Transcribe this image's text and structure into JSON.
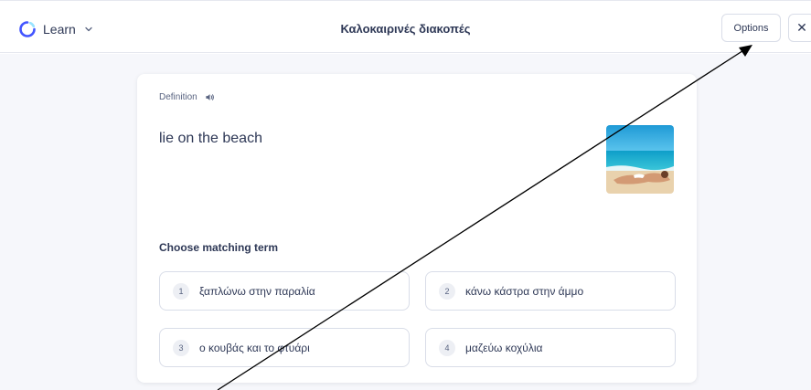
{
  "header": {
    "mode_label": "Learn",
    "mode_icon": "learn-mode-icon",
    "title": "Καλοκαιρινές διακοπές",
    "options_label": "Options",
    "close_label": "✕"
  },
  "question": {
    "definition_label": "Definition",
    "prompt": "lie on the beach",
    "image_subject": "woman sunbathing on the beach",
    "choose_label": "Choose matching term"
  },
  "answers": [
    {
      "number": "1",
      "text": "ξαπλώνω στην παραλία"
    },
    {
      "number": "2",
      "text": "κάνω κάστρα στην άμμο"
    },
    {
      "number": "3",
      "text": "ο κουβάς και το φτυάρι"
    },
    {
      "number": "4",
      "text": "μαζεύω κοχύλια"
    }
  ],
  "colors": {
    "accent": "#4255ff",
    "text": "#2e3856",
    "muted": "#586380",
    "border": "#d9dde8",
    "background": "#f6f7fb"
  }
}
